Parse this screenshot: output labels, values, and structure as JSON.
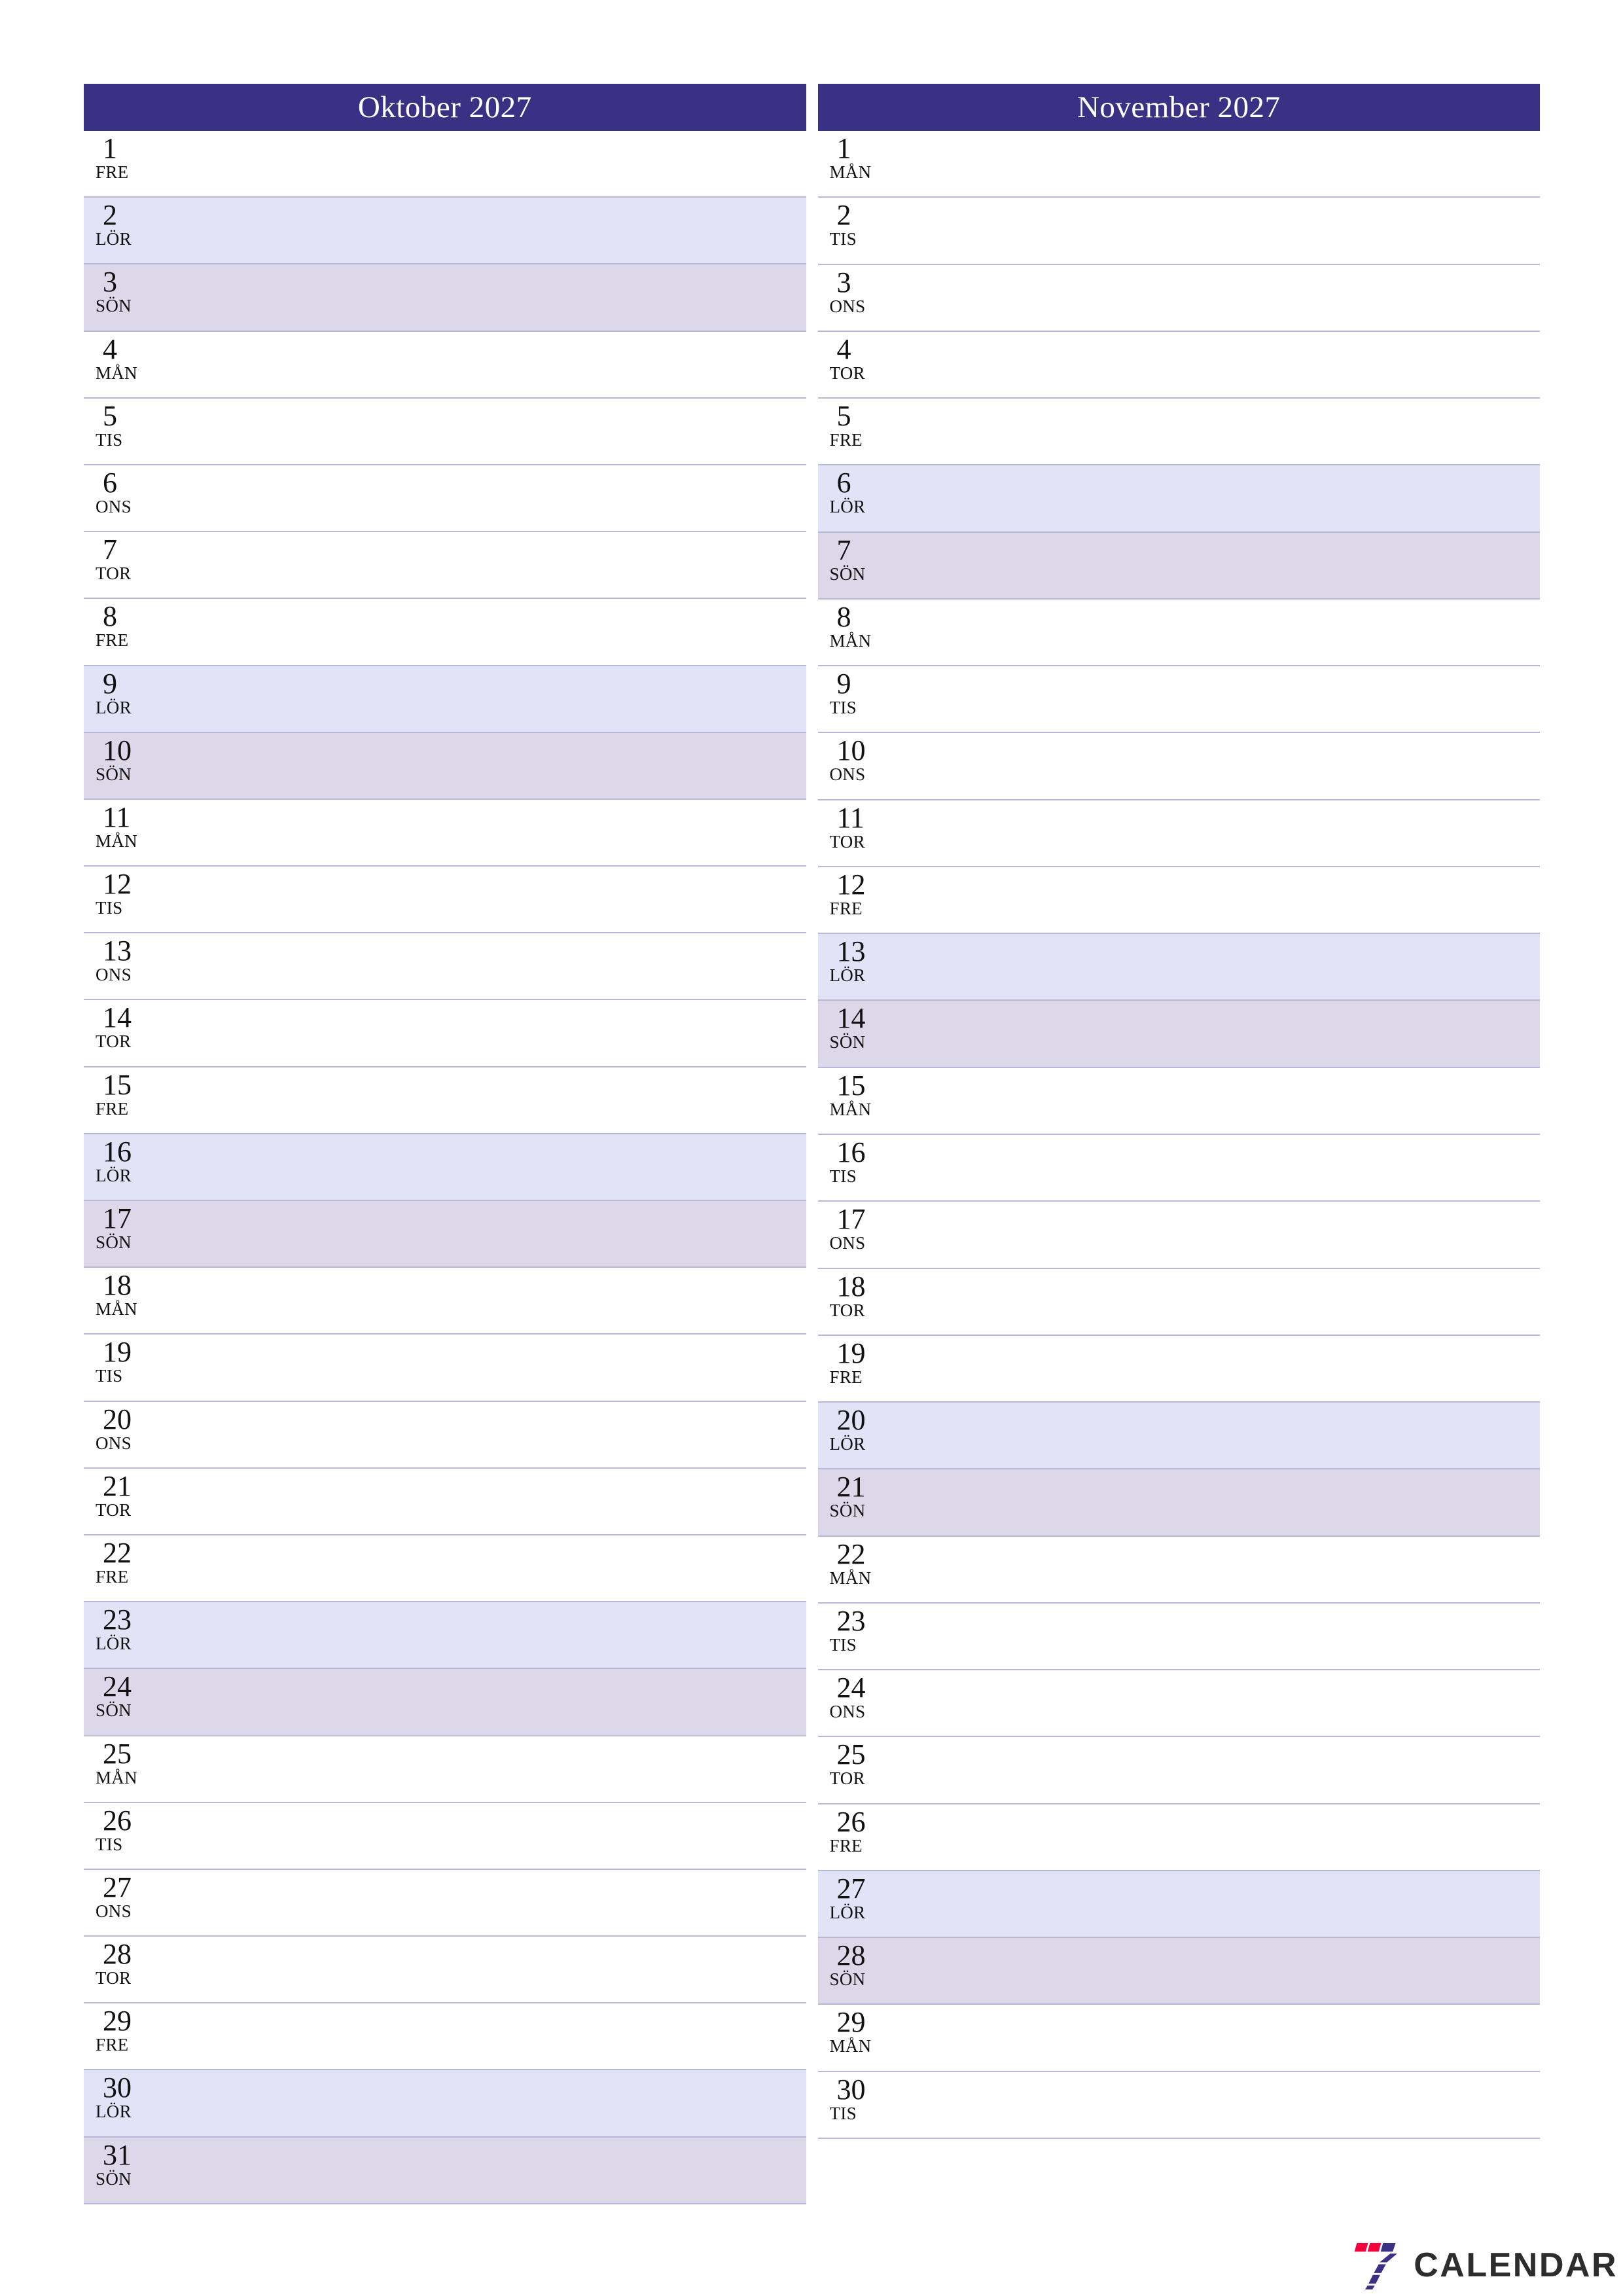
{
  "colors": {
    "header_bg": "#3a3185",
    "header_text": "#ffffff",
    "saturday_bg": "#e3e3f8",
    "sunday_bg": "#dcd8ea",
    "row_border": "#b9b8d9",
    "day_text": "#111111",
    "logo_red": "#f5003c",
    "logo_indigo": "#3a3185",
    "logo_text": "#2d2d2f"
  },
  "brand": {
    "name": "CALENDAR",
    "mark": "seven-logo-icon"
  },
  "months": [
    {
      "title": "Oktober 2027",
      "days": [
        {
          "num": "1",
          "abbr": "FRE",
          "type": "weekday"
        },
        {
          "num": "2",
          "abbr": "LÖR",
          "type": "sat"
        },
        {
          "num": "3",
          "abbr": "SÖN",
          "type": "sun"
        },
        {
          "num": "4",
          "abbr": "MÅN",
          "type": "weekday"
        },
        {
          "num": "5",
          "abbr": "TIS",
          "type": "weekday"
        },
        {
          "num": "6",
          "abbr": "ONS",
          "type": "weekday"
        },
        {
          "num": "7",
          "abbr": "TOR",
          "type": "weekday"
        },
        {
          "num": "8",
          "abbr": "FRE",
          "type": "weekday"
        },
        {
          "num": "9",
          "abbr": "LÖR",
          "type": "sat"
        },
        {
          "num": "10",
          "abbr": "SÖN",
          "type": "sun"
        },
        {
          "num": "11",
          "abbr": "MÅN",
          "type": "weekday"
        },
        {
          "num": "12",
          "abbr": "TIS",
          "type": "weekday"
        },
        {
          "num": "13",
          "abbr": "ONS",
          "type": "weekday"
        },
        {
          "num": "14",
          "abbr": "TOR",
          "type": "weekday"
        },
        {
          "num": "15",
          "abbr": "FRE",
          "type": "weekday"
        },
        {
          "num": "16",
          "abbr": "LÖR",
          "type": "sat"
        },
        {
          "num": "17",
          "abbr": "SÖN",
          "type": "sun"
        },
        {
          "num": "18",
          "abbr": "MÅN",
          "type": "weekday"
        },
        {
          "num": "19",
          "abbr": "TIS",
          "type": "weekday"
        },
        {
          "num": "20",
          "abbr": "ONS",
          "type": "weekday"
        },
        {
          "num": "21",
          "abbr": "TOR",
          "type": "weekday"
        },
        {
          "num": "22",
          "abbr": "FRE",
          "type": "weekday"
        },
        {
          "num": "23",
          "abbr": "LÖR",
          "type": "sat"
        },
        {
          "num": "24",
          "abbr": "SÖN",
          "type": "sun"
        },
        {
          "num": "25",
          "abbr": "MÅN",
          "type": "weekday"
        },
        {
          "num": "26",
          "abbr": "TIS",
          "type": "weekday"
        },
        {
          "num": "27",
          "abbr": "ONS",
          "type": "weekday"
        },
        {
          "num": "28",
          "abbr": "TOR",
          "type": "weekday"
        },
        {
          "num": "29",
          "abbr": "FRE",
          "type": "weekday"
        },
        {
          "num": "30",
          "abbr": "LÖR",
          "type": "sat"
        },
        {
          "num": "31",
          "abbr": "SÖN",
          "type": "sun"
        }
      ]
    },
    {
      "title": "November 2027",
      "days": [
        {
          "num": "1",
          "abbr": "MÅN",
          "type": "weekday"
        },
        {
          "num": "2",
          "abbr": "TIS",
          "type": "weekday"
        },
        {
          "num": "3",
          "abbr": "ONS",
          "type": "weekday"
        },
        {
          "num": "4",
          "abbr": "TOR",
          "type": "weekday"
        },
        {
          "num": "5",
          "abbr": "FRE",
          "type": "weekday"
        },
        {
          "num": "6",
          "abbr": "LÖR",
          "type": "sat"
        },
        {
          "num": "7",
          "abbr": "SÖN",
          "type": "sun"
        },
        {
          "num": "8",
          "abbr": "MÅN",
          "type": "weekday"
        },
        {
          "num": "9",
          "abbr": "TIS",
          "type": "weekday"
        },
        {
          "num": "10",
          "abbr": "ONS",
          "type": "weekday"
        },
        {
          "num": "11",
          "abbr": "TOR",
          "type": "weekday"
        },
        {
          "num": "12",
          "abbr": "FRE",
          "type": "weekday"
        },
        {
          "num": "13",
          "abbr": "LÖR",
          "type": "sat"
        },
        {
          "num": "14",
          "abbr": "SÖN",
          "type": "sun"
        },
        {
          "num": "15",
          "abbr": "MÅN",
          "type": "weekday"
        },
        {
          "num": "16",
          "abbr": "TIS",
          "type": "weekday"
        },
        {
          "num": "17",
          "abbr": "ONS",
          "type": "weekday"
        },
        {
          "num": "18",
          "abbr": "TOR",
          "type": "weekday"
        },
        {
          "num": "19",
          "abbr": "FRE",
          "type": "weekday"
        },
        {
          "num": "20",
          "abbr": "LÖR",
          "type": "sat"
        },
        {
          "num": "21",
          "abbr": "SÖN",
          "type": "sun"
        },
        {
          "num": "22",
          "abbr": "MÅN",
          "type": "weekday"
        },
        {
          "num": "23",
          "abbr": "TIS",
          "type": "weekday"
        },
        {
          "num": "24",
          "abbr": "ONS",
          "type": "weekday"
        },
        {
          "num": "25",
          "abbr": "TOR",
          "type": "weekday"
        },
        {
          "num": "26",
          "abbr": "FRE",
          "type": "weekday"
        },
        {
          "num": "27",
          "abbr": "LÖR",
          "type": "sat"
        },
        {
          "num": "28",
          "abbr": "SÖN",
          "type": "sun"
        },
        {
          "num": "29",
          "abbr": "MÅN",
          "type": "weekday"
        },
        {
          "num": "30",
          "abbr": "TIS",
          "type": "weekday"
        },
        {
          "num": "",
          "abbr": "",
          "type": "empty"
        }
      ]
    }
  ]
}
